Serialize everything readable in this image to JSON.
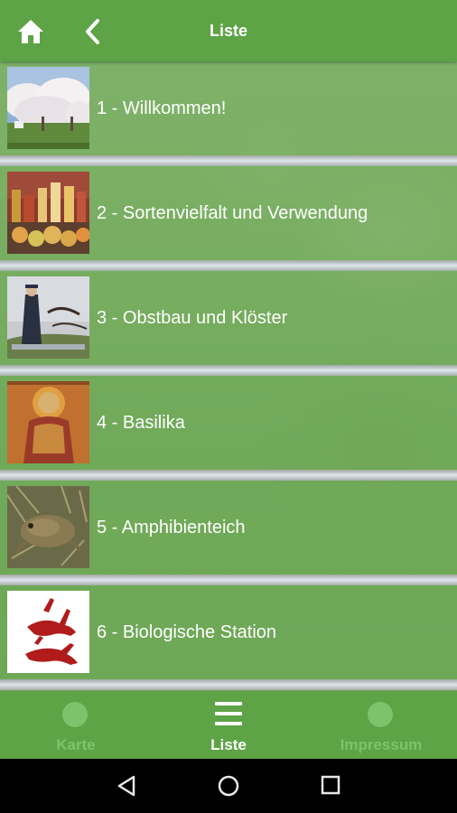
{
  "header": {
    "title": "Liste",
    "home_icon": "home-icon",
    "back_icon": "chevron-left-icon"
  },
  "list": {
    "items": [
      {
        "label": "1 - Willkommen!",
        "thumb": "blossoming-orchard"
      },
      {
        "label": "2 - Sortenvielfalt und Verwendung",
        "thumb": "apple-products"
      },
      {
        "label": "3 - Obstbau und Klöster",
        "thumb": "monk-painting"
      },
      {
        "label": "4 - Basilika",
        "thumb": "fresco"
      },
      {
        "label": "5 - Amphibienteich",
        "thumb": "toad"
      },
      {
        "label": "6 - Biologische Station",
        "thumb": "hare-logo"
      }
    ]
  },
  "bottom_nav": {
    "items": [
      {
        "label": "Karte",
        "icon": "map-pin-icon",
        "active": false
      },
      {
        "label": "Liste",
        "icon": "list-icon",
        "active": true
      },
      {
        "label": "Impressum",
        "icon": "info-icon",
        "active": false
      }
    ]
  },
  "system_nav": {
    "back": "back-triangle-icon",
    "home": "home-circle-icon",
    "recents": "recents-square-icon"
  },
  "colors": {
    "primary": "#5ea345",
    "inactive_nav": "#7ec26b",
    "row_overlay": "#6eaa55"
  }
}
